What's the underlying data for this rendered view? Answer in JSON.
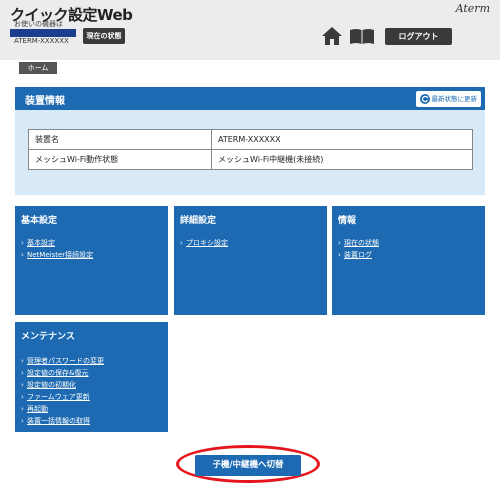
{
  "header": {
    "app_title": "クイック設定Web",
    "device_caption": "お使いの機器は",
    "device_model": "ATERM-XXXXXX",
    "status_button": "現在の状態",
    "brand": "Aterm",
    "logout_button": "ログアウト"
  },
  "breadcrumb": {
    "home": "ホーム"
  },
  "device_info": {
    "title": "装置情報",
    "refresh_button": "最新状態に更新",
    "rows": [
      {
        "label": "装置名",
        "value": "ATERM-XXXXXX"
      },
      {
        "label": "メッシュWi-Fi動作状態",
        "value": "メッシュWi-Fi中継機(未接続)"
      }
    ]
  },
  "menus": {
    "basic": {
      "title": "基本設定",
      "items": [
        "基本設定",
        "NetMeister接続設定"
      ]
    },
    "advanced": {
      "title": "詳細設定",
      "items": [
        "プロキシ設定"
      ]
    },
    "info": {
      "title": "情報",
      "items": [
        "現在の状態",
        "装置ログ"
      ]
    },
    "maintenance": {
      "title": "メンテナンス",
      "items": [
        "管理者パスワードの変更",
        "設定値の保存&復元",
        "設定値の初期化",
        "ファームウェア更新",
        "再起動",
        "装置一括情報の取得"
      ]
    }
  },
  "switch_button": "子機/中継機へ切替",
  "colors": {
    "primary_blue": "#1d6ab2",
    "highlight_red": "#e8141d"
  }
}
